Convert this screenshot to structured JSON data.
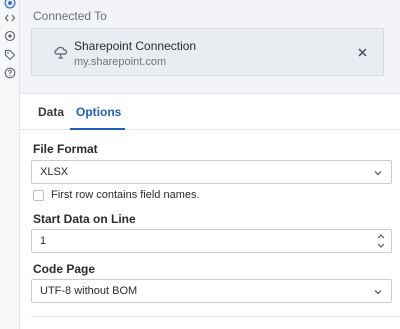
{
  "rail": {
    "icons": [
      "settings-icon",
      "code-icon",
      "target-icon",
      "tag-icon",
      "help-icon"
    ]
  },
  "connection": {
    "section_label": "Connected To",
    "name": "Sharepoint Connection",
    "url": "my.sharepoint.com"
  },
  "tabs": {
    "data_label": "Data",
    "options_label": "Options",
    "active": "Options"
  },
  "file_format": {
    "label": "File Format",
    "value": "XLSX"
  },
  "header_checkbox": {
    "label": "First row contains field names.",
    "checked": false
  },
  "start_line": {
    "label": "Start Data on Line",
    "value": "1"
  },
  "code_page": {
    "label": "Code Page",
    "value": "UTF-8 without BOM"
  },
  "colors": {
    "accent": "#1f5fbf",
    "border": "#c9ced4",
    "section_bg": "#f2f4f7"
  }
}
